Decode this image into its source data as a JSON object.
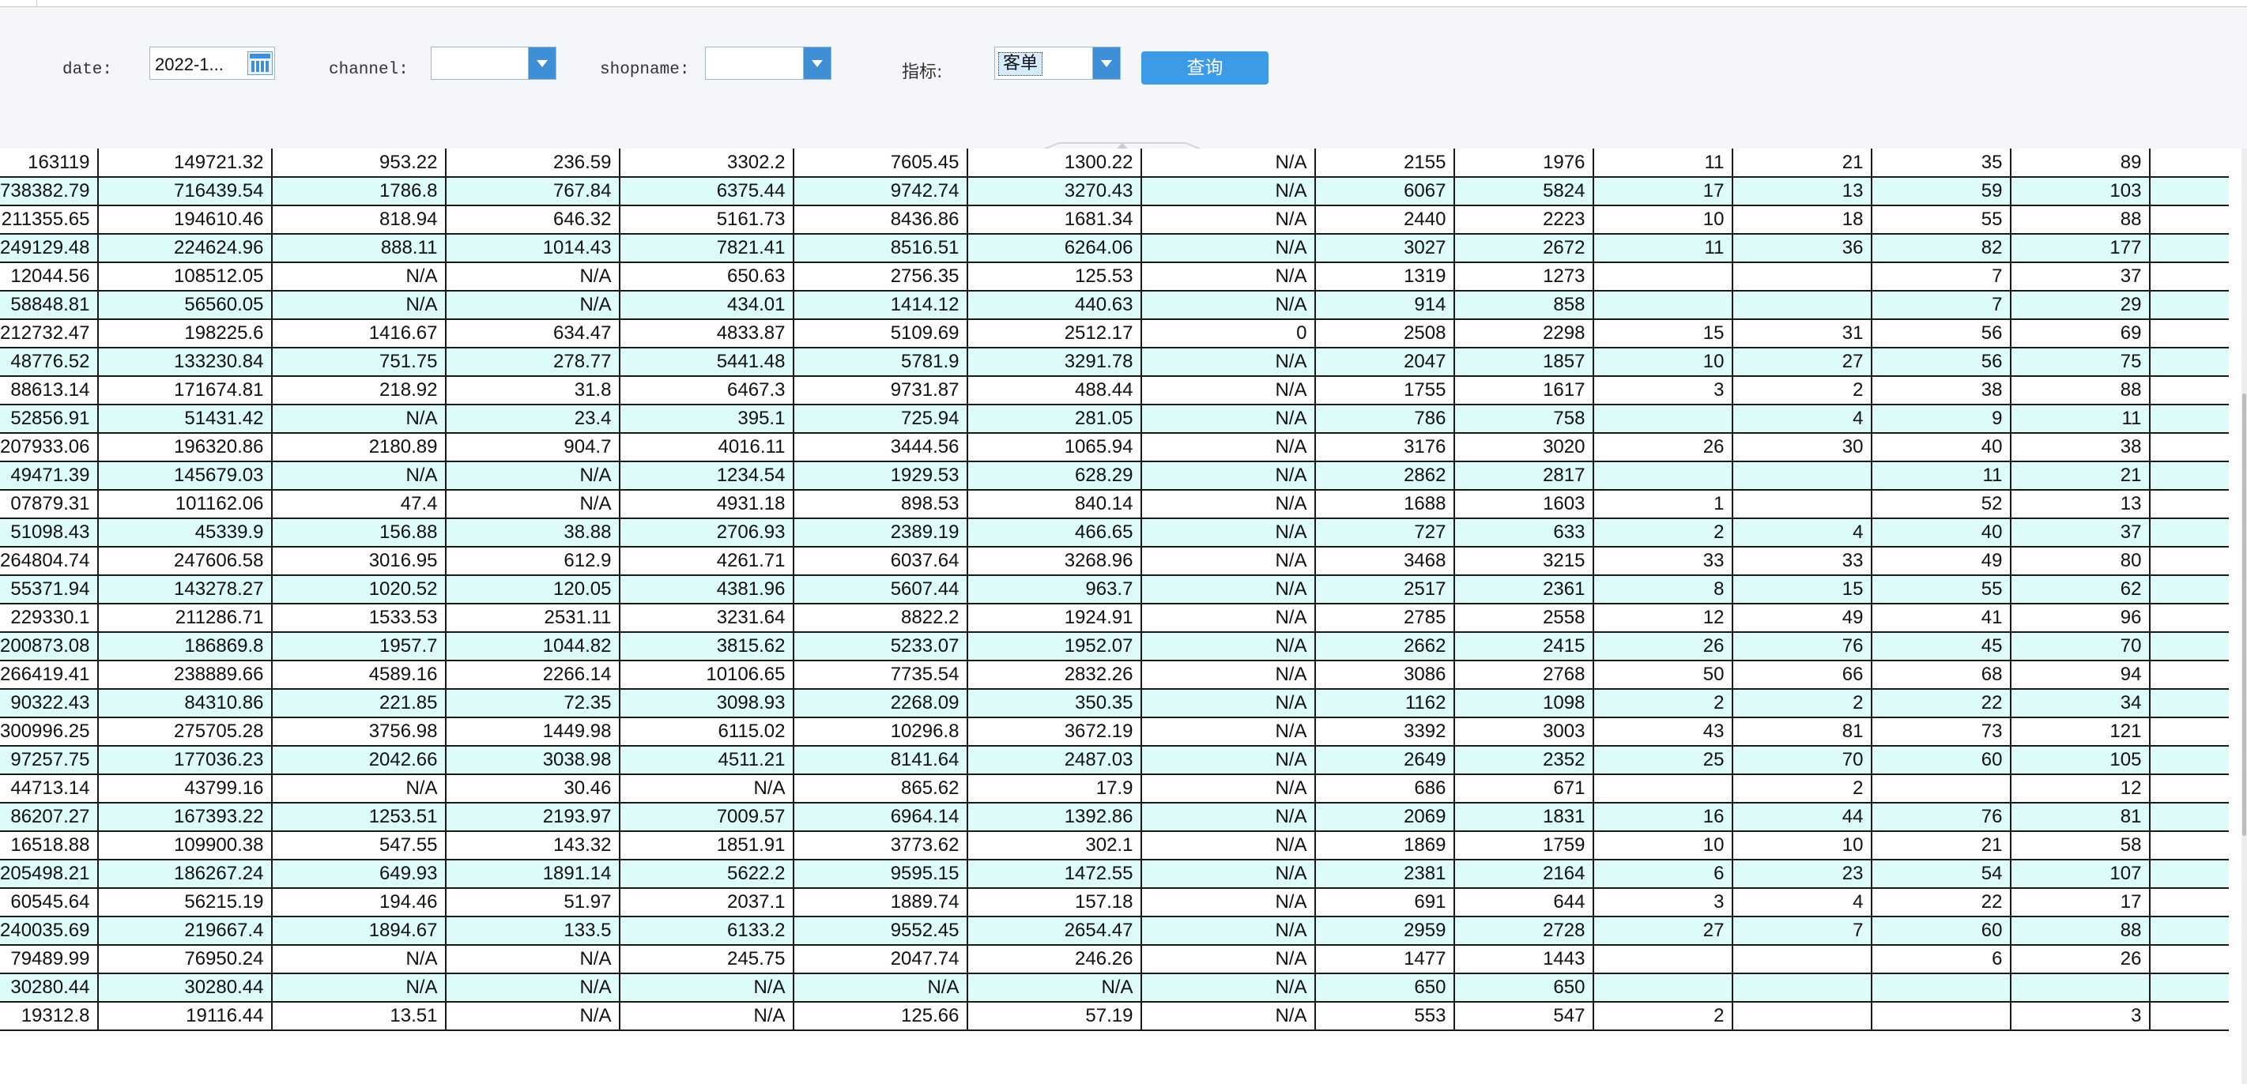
{
  "filters": {
    "date_label": "date:",
    "date_value": "2022-1...",
    "channel_label": "channel:",
    "channel_value": "",
    "shopname_label": "shopname:",
    "shopname_value": "",
    "metric_label": "指标:",
    "metric_value": "客单",
    "query_button": "查询"
  },
  "table": {
    "rows": [
      [
        "163119",
        "149721.32",
        "953.22",
        "236.59",
        "3302.2",
        "7605.45",
        "1300.22",
        "N/A",
        "2155",
        "1976",
        "11",
        "21",
        "35",
        "89",
        ""
      ],
      [
        "738382.79",
        "716439.54",
        "1786.8",
        "767.84",
        "6375.44",
        "9742.74",
        "3270.43",
        "N/A",
        "6067",
        "5824",
        "17",
        "13",
        "59",
        "103",
        ""
      ],
      [
        "211355.65",
        "194610.46",
        "818.94",
        "646.32",
        "5161.73",
        "8436.86",
        "1681.34",
        "N/A",
        "2440",
        "2223",
        "10",
        "18",
        "55",
        "88",
        ""
      ],
      [
        "249129.48",
        "224624.96",
        "888.11",
        "1014.43",
        "7821.41",
        "8516.51",
        "6264.06",
        "N/A",
        "3027",
        "2672",
        "11",
        "36",
        "82",
        "177",
        ""
      ],
      [
        "12044.56",
        "108512.05",
        "N/A",
        "N/A",
        "650.63",
        "2756.35",
        "125.53",
        "N/A",
        "1319",
        "1273",
        "",
        "",
        "7",
        "37",
        ""
      ],
      [
        "58848.81",
        "56560.05",
        "N/A",
        "N/A",
        "434.01",
        "1414.12",
        "440.63",
        "N/A",
        "914",
        "858",
        "",
        "",
        "7",
        "29",
        ""
      ],
      [
        "212732.47",
        "198225.6",
        "1416.67",
        "634.47",
        "4833.87",
        "5109.69",
        "2512.17",
        "0",
        "2508",
        "2298",
        "15",
        "31",
        "56",
        "69",
        ""
      ],
      [
        "48776.52",
        "133230.84",
        "751.75",
        "278.77",
        "5441.48",
        "5781.9",
        "3291.78",
        "N/A",
        "2047",
        "1857",
        "10",
        "27",
        "56",
        "75",
        ""
      ],
      [
        "88613.14",
        "171674.81",
        "218.92",
        "31.8",
        "6467.3",
        "9731.87",
        "488.44",
        "N/A",
        "1755",
        "1617",
        "3",
        "2",
        "38",
        "88",
        ""
      ],
      [
        "52856.91",
        "51431.42",
        "N/A",
        "23.4",
        "395.1",
        "725.94",
        "281.05",
        "N/A",
        "786",
        "758",
        "",
        "4",
        "9",
        "11",
        ""
      ],
      [
        "207933.06",
        "196320.86",
        "2180.89",
        "904.7",
        "4016.11",
        "3444.56",
        "1065.94",
        "N/A",
        "3176",
        "3020",
        "26",
        "30",
        "40",
        "38",
        ""
      ],
      [
        "49471.39",
        "145679.03",
        "N/A",
        "N/A",
        "1234.54",
        "1929.53",
        "628.29",
        "N/A",
        "2862",
        "2817",
        "",
        "",
        "11",
        "21",
        ""
      ],
      [
        "07879.31",
        "101162.06",
        "47.4",
        "N/A",
        "4931.18",
        "898.53",
        "840.14",
        "N/A",
        "1688",
        "1603",
        "1",
        "",
        "52",
        "13",
        ""
      ],
      [
        "51098.43",
        "45339.9",
        "156.88",
        "38.88",
        "2706.93",
        "2389.19",
        "466.65",
        "N/A",
        "727",
        "633",
        "2",
        "4",
        "40",
        "37",
        ""
      ],
      [
        "264804.74",
        "247606.58",
        "3016.95",
        "612.9",
        "4261.71",
        "6037.64",
        "3268.96",
        "N/A",
        "3468",
        "3215",
        "33",
        "33",
        "49",
        "80",
        ""
      ],
      [
        "55371.94",
        "143278.27",
        "1020.52",
        "120.05",
        "4381.96",
        "5607.44",
        "963.7",
        "N/A",
        "2517",
        "2361",
        "8",
        "15",
        "55",
        "62",
        ""
      ],
      [
        "229330.1",
        "211286.71",
        "1533.53",
        "2531.11",
        "3231.64",
        "8822.2",
        "1924.91",
        "N/A",
        "2785",
        "2558",
        "12",
        "49",
        "41",
        "96",
        ""
      ],
      [
        "200873.08",
        "186869.8",
        "1957.7",
        "1044.82",
        "3815.62",
        "5233.07",
        "1952.07",
        "N/A",
        "2662",
        "2415",
        "26",
        "76",
        "45",
        "70",
        ""
      ],
      [
        "266419.41",
        "238889.66",
        "4589.16",
        "2266.14",
        "10106.65",
        "7735.54",
        "2832.26",
        "N/A",
        "3086",
        "2768",
        "50",
        "66",
        "68",
        "94",
        ""
      ],
      [
        "90322.43",
        "84310.86",
        "221.85",
        "72.35",
        "3098.93",
        "2268.09",
        "350.35",
        "N/A",
        "1162",
        "1098",
        "2",
        "2",
        "22",
        "34",
        ""
      ],
      [
        "300996.25",
        "275705.28",
        "3756.98",
        "1449.98",
        "6115.02",
        "10296.8",
        "3672.19",
        "N/A",
        "3392",
        "3003",
        "43",
        "81",
        "73",
        "121",
        ""
      ],
      [
        "97257.75",
        "177036.23",
        "2042.66",
        "3038.98",
        "4511.21",
        "8141.64",
        "2487.03",
        "N/A",
        "2649",
        "2352",
        "25",
        "70",
        "60",
        "105",
        ""
      ],
      [
        "44713.14",
        "43799.16",
        "N/A",
        "30.46",
        "N/A",
        "865.62",
        "17.9",
        "N/A",
        "686",
        "671",
        "",
        "2",
        "",
        "12",
        ""
      ],
      [
        "86207.27",
        "167393.22",
        "1253.51",
        "2193.97",
        "7009.57",
        "6964.14",
        "1392.86",
        "N/A",
        "2069",
        "1831",
        "16",
        "44",
        "76",
        "81",
        ""
      ],
      [
        "16518.88",
        "109900.38",
        "547.55",
        "143.32",
        "1851.91",
        "3773.62",
        "302.1",
        "N/A",
        "1869",
        "1759",
        "10",
        "10",
        "21",
        "58",
        ""
      ],
      [
        "205498.21",
        "186267.24",
        "649.93",
        "1891.14",
        "5622.2",
        "9595.15",
        "1472.55",
        "N/A",
        "2381",
        "2164",
        "6",
        "23",
        "54",
        "107",
        ""
      ],
      [
        "60545.64",
        "56215.19",
        "194.46",
        "51.97",
        "2037.1",
        "1889.74",
        "157.18",
        "N/A",
        "691",
        "644",
        "3",
        "4",
        "22",
        "17",
        ""
      ],
      [
        "240035.69",
        "219667.4",
        "1894.67",
        "133.5",
        "6133.2",
        "9552.45",
        "2654.47",
        "N/A",
        "2959",
        "2728",
        "27",
        "7",
        "60",
        "88",
        ""
      ],
      [
        "79489.99",
        "76950.24",
        "N/A",
        "N/A",
        "245.75",
        "2047.74",
        "246.26",
        "N/A",
        "1477",
        "1443",
        "",
        "",
        "6",
        "26",
        ""
      ],
      [
        "30280.44",
        "30280.44",
        "N/A",
        "N/A",
        "N/A",
        "N/A",
        "N/A",
        "N/A",
        "650",
        "650",
        "",
        "",
        "",
        "",
        ""
      ],
      [
        "19312.8",
        "19116.44",
        "13.51",
        "N/A",
        "N/A",
        "125.66",
        "57.19",
        "N/A",
        "553",
        "547",
        "2",
        "",
        "",
        "3",
        ""
      ]
    ]
  },
  "colors": {
    "row_odd": "#ffffff",
    "row_even": "#dcfbf9",
    "accent": "#3c9be6"
  }
}
